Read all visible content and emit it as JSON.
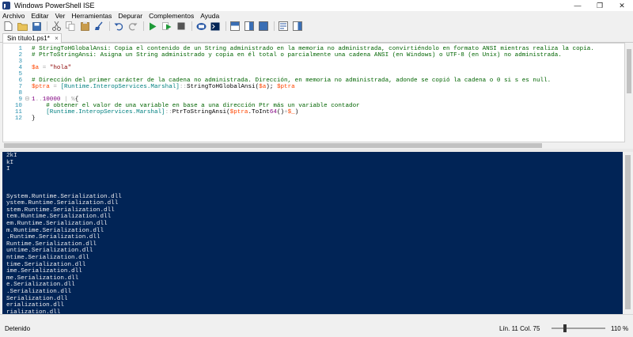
{
  "window": {
    "title": "Windows PowerShell ISE",
    "controls": {
      "minimize": "—",
      "maximize": "❐",
      "close": "✕"
    }
  },
  "menu": [
    "Archivo",
    "Editar",
    "Ver",
    "Herramientas",
    "Depurar",
    "Complementos",
    "Ayuda"
  ],
  "toolbar": {
    "buttons": [
      "new-file",
      "open-file",
      "save",
      "cut",
      "copy",
      "paste",
      "clear",
      "undo",
      "redo",
      "run",
      "run-selection",
      "stop",
      "new-remote-tab",
      "console",
      "show-script-top",
      "show-script-right",
      "show-script-max",
      "show-command",
      "show-addon"
    ]
  },
  "tab": {
    "title": "Sin título1.ps1*",
    "close": "×"
  },
  "editor": {
    "lines": [
      {
        "num": "1",
        "fold": "",
        "text": "# StringToHGlobalAnsi: Copia el contenido de un String administrado en la memoria no administrada, convirtiéndolo en formato ANSI mientras realiza la copia."
      },
      {
        "num": "2",
        "fold": "",
        "text": "# PtrToStringAnsi: Asigna un String administrado y copia en él total o parcialmente una cadena ANSI (en Windows) o UTF-8 (en Unix) no administrada."
      },
      {
        "num": "3",
        "fold": "",
        "text": ""
      },
      {
        "num": "4",
        "fold": "",
        "text": "$a = \"hola\""
      },
      {
        "num": "5",
        "fold": "",
        "text": ""
      },
      {
        "num": "6",
        "fold": "",
        "text": "# Dirección del primer carácter de la cadena no administrada. Dirección, en memoria no administrada, adonde se copió la cadena o 0 si s es null."
      },
      {
        "num": "7",
        "fold": "",
        "text": "$ptra = [Runtime.InteropServices.Marshal]::StringToHGlobalAnsi($a); $ptra"
      },
      {
        "num": "8",
        "fold": "",
        "text": ""
      },
      {
        "num": "9",
        "fold": "⊟",
        "text": "1..10000 | %{"
      },
      {
        "num": "10",
        "fold": "",
        "text": "    # obtener el valor de una variable en base a una dirección Ptr más un variable contador"
      },
      {
        "num": "11",
        "fold": "",
        "text": "    [Runtime.InteropServices.Marshal]::PtrToStringAnsi($ptra.ToInt64()+$_)"
      },
      {
        "num": "12",
        "fold": "",
        "text": "}"
      }
    ]
  },
  "console": {
    "lines": [
      "2kI",
      "kI",
      "I",
      "",
      "",
      "",
      "System.Runtime.Serialization.dll",
      "ystem.Runtime.Serialization.dll",
      "stem.Runtime.Serialization.dll",
      "tem.Runtime.Serialization.dll",
      "em.Runtime.Serialization.dll",
      "m.Runtime.Serialization.dll",
      ".Runtime.Serialization.dll",
      "Runtime.Serialization.dll",
      "untime.Serialization.dll",
      "ntime.Serialization.dll",
      "time.Serialization.dll",
      "ime.Serialization.dll",
      "me.Serialization.dll",
      "e.Serialization.dll",
      ".Serialization.dll",
      "Serialization.dll",
      "erialization.dll",
      "rialization.dll"
    ]
  },
  "status": {
    "text": "Detenido",
    "position": "Lín. 11  Col. 75",
    "zoom": "110 %",
    "zoom_level_percent": 110
  },
  "colors": {
    "console_bg": "#012456",
    "console_fg": "#eeedf0",
    "comment": "#006400",
    "variable": "#ff4500",
    "string": "#8b0000",
    "type": "#008080",
    "line_number": "#2b91af"
  }
}
